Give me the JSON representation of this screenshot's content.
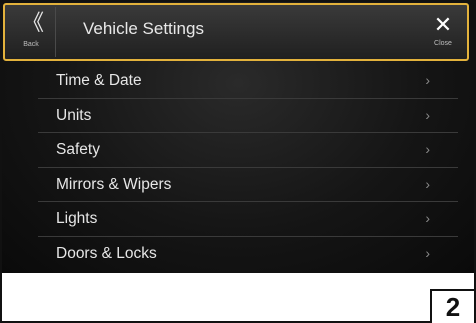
{
  "header": {
    "back_label": "Back",
    "back_icon": "chevron-double-left-icon",
    "title": "Vehicle Settings",
    "close_label": "Close",
    "close_icon": "close-icon"
  },
  "menu": {
    "items": [
      {
        "label": "Time & Date"
      },
      {
        "label": "Units"
      },
      {
        "label": "Safety"
      },
      {
        "label": "Mirrors & Wipers"
      },
      {
        "label": "Lights"
      },
      {
        "label": "Doors & Locks"
      }
    ],
    "chevron_icon": "chevron-right-icon"
  },
  "page_number": "2",
  "colors": {
    "header_border": "#e3b23c",
    "screen_background": "#151515",
    "text": "#e6e6e6"
  }
}
